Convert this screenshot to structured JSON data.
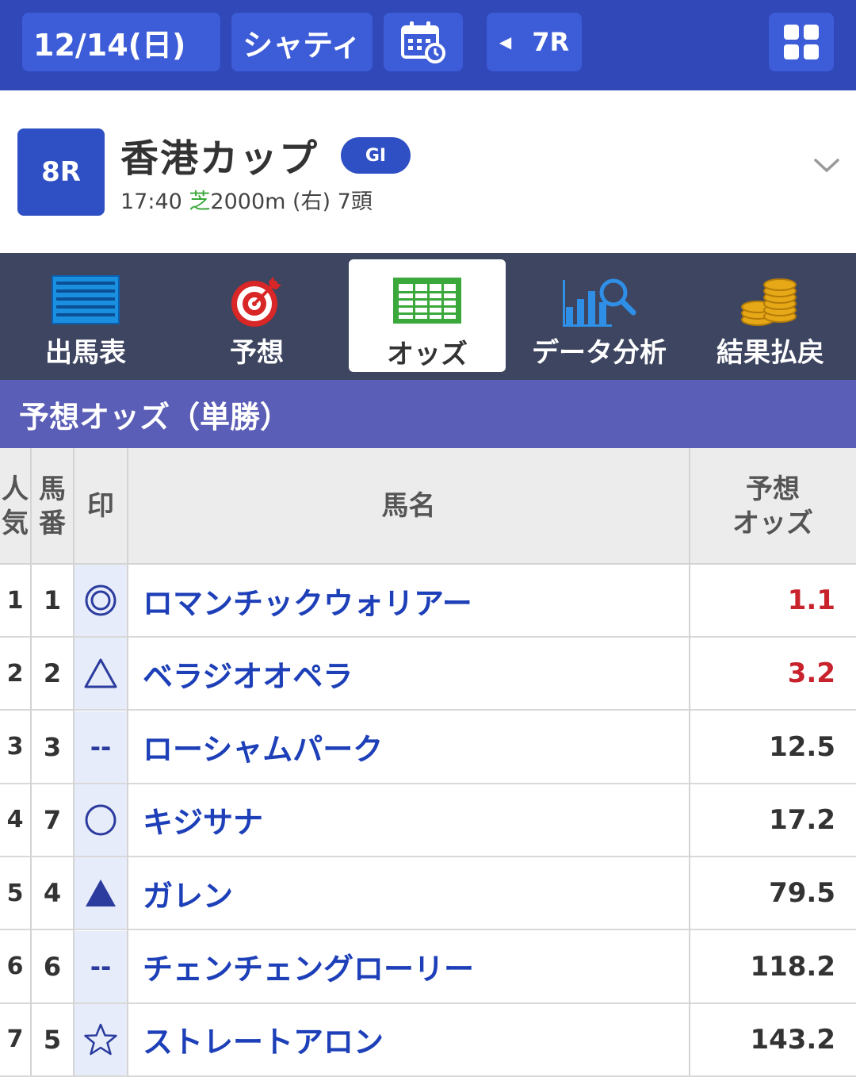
{
  "topbar": {
    "date": "12/14(日)",
    "venue": "シャティ",
    "prev_race": "7R",
    "icons": [
      "calendar-refresh-icon",
      "grid-menu-icon",
      "prev-triangle-icon"
    ]
  },
  "race": {
    "number": "8R",
    "name": "香港カップ",
    "grade": "GI",
    "time": "17:40",
    "surface": "芝",
    "distance_direction": "2000m (右)",
    "runners": "7頭"
  },
  "tabs": [
    {
      "label": "出馬表",
      "icon": "entry-table-icon",
      "active": false
    },
    {
      "label": "予想",
      "icon": "target-icon",
      "active": false
    },
    {
      "label": "オッズ",
      "icon": "odds-sheet-icon",
      "active": true
    },
    {
      "label": "データ分析",
      "icon": "chart-search-icon",
      "active": false
    },
    {
      "label": "結果払戻",
      "icon": "coins-icon",
      "active": false
    }
  ],
  "section_title": "予想オッズ（単勝）",
  "table": {
    "headers": {
      "popularity": "人気",
      "horse_no": "馬番",
      "mark": "印",
      "name": "馬名",
      "odds": "予想オッズ"
    },
    "rows": [
      {
        "rank": "1",
        "no": "1",
        "mark": "double-circle",
        "name": "ロマンチックウォリアー",
        "odds": "1.1",
        "hot": true
      },
      {
        "rank": "2",
        "no": "2",
        "mark": "triangle",
        "name": "ベラジオオペラ",
        "odds": "3.2",
        "hot": true
      },
      {
        "rank": "3",
        "no": "3",
        "mark": "--",
        "name": "ローシャムパーク",
        "odds": "12.5",
        "hot": false
      },
      {
        "rank": "4",
        "no": "7",
        "mark": "circle",
        "name": "キジサナ",
        "odds": "17.2",
        "hot": false
      },
      {
        "rank": "5",
        "no": "4",
        "mark": "filled-triangle",
        "name": "ガレン",
        "odds": "79.5",
        "hot": false
      },
      {
        "rank": "6",
        "no": "6",
        "mark": "--",
        "name": "チェンチェングローリー",
        "odds": "118.2",
        "hot": false
      },
      {
        "rank": "7",
        "no": "5",
        "mark": "star",
        "name": "ストレートアロン",
        "odds": "143.2",
        "hot": false
      }
    ]
  },
  "colors": {
    "topbar": "#3048b8",
    "accent_blue": "#2f4fc4",
    "tabs_bg": "#3d4560",
    "section_bg": "#5a5eb6",
    "horse_name": "#1d3fb8",
    "hot_odds": "#c8232c",
    "turf_green": "#3aa83a"
  }
}
